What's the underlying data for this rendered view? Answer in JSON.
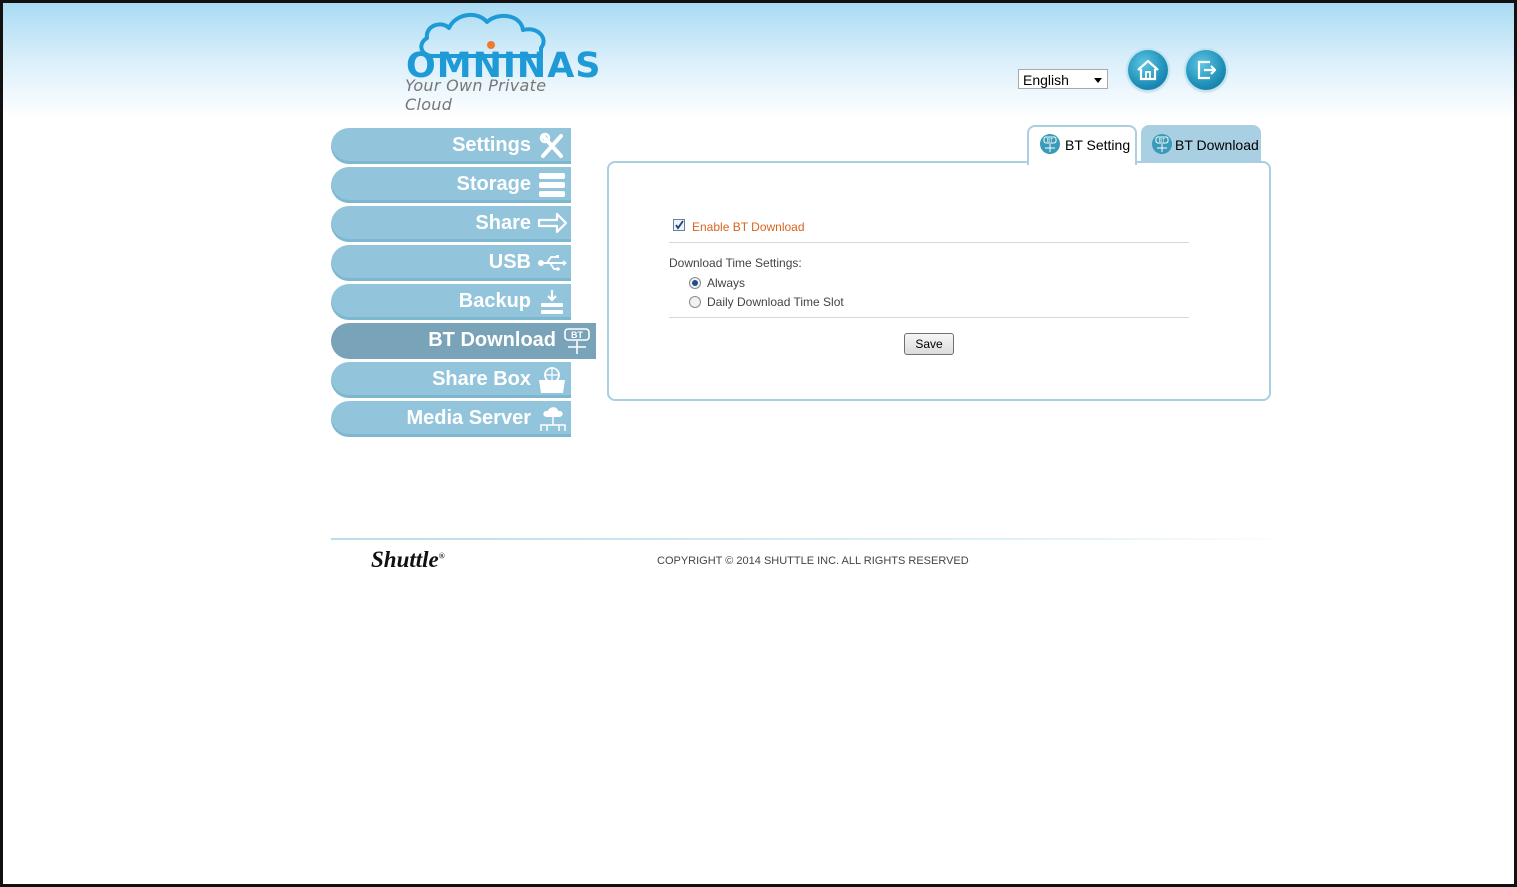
{
  "header": {
    "logo": {
      "name": "OMNINAS",
      "tagline": "Your Own Private Cloud"
    },
    "language": {
      "selected": "English"
    },
    "home_icon": "home-icon",
    "logout_icon": "logout-icon"
  },
  "sidebar": {
    "items": [
      {
        "label": "Settings",
        "icon": "tools-icon",
        "active": false
      },
      {
        "label": "Storage",
        "icon": "storage-icon",
        "active": false
      },
      {
        "label": "Share",
        "icon": "share-icon",
        "active": false
      },
      {
        "label": "USB",
        "icon": "usb-icon",
        "active": false
      },
      {
        "label": "Backup",
        "icon": "backup-icon",
        "active": false
      },
      {
        "label": "BT Download",
        "icon": "bt-download-icon",
        "active": true
      },
      {
        "label": "Share Box",
        "icon": "share-box-icon",
        "active": false
      },
      {
        "label": "Media Server",
        "icon": "media-server-icon",
        "active": false
      }
    ]
  },
  "tabs": [
    {
      "label": "BT Setting",
      "active": true
    },
    {
      "label": "BT Download",
      "active": false
    }
  ],
  "form": {
    "enable_bt": {
      "label": "Enable BT Download",
      "checked": true
    },
    "time_settings_label": "Download Time Settings:",
    "options": [
      {
        "label": "Always",
        "checked": true
      },
      {
        "label": "Daily Download Time Slot",
        "checked": false
      }
    ],
    "save_label": "Save"
  },
  "footer": {
    "brand": "Shuttle",
    "copyright": "COPYRIGHT © 2014 SHUTTLE INC. ALL RIGHTS RESERVED"
  },
  "colors": {
    "menu": "#92c5dc",
    "menu_active": "#78a3b8",
    "accent_orange": "#d9641e",
    "logo_blue": "#1e9ad6"
  }
}
